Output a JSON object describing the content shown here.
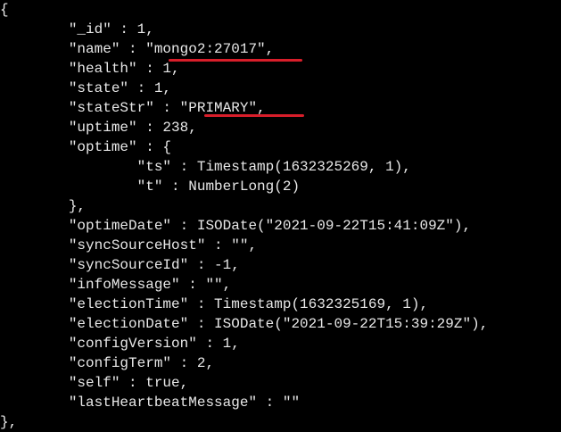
{
  "terminal": {
    "lines": [
      "{",
      "        \"_id\" : 1,",
      "        \"name\" : \"mongo2:27017\",",
      "        \"health\" : 1,",
      "        \"state\" : 1,",
      "        \"stateStr\" : \"PRIMARY\",",
      "        \"uptime\" : 238,",
      "        \"optime\" : {",
      "                \"ts\" : Timestamp(1632325269, 1),",
      "                \"t\" : NumberLong(2)",
      "        },",
      "        \"optimeDate\" : ISODate(\"2021-09-22T15:41:09Z\"),",
      "        \"syncSourceHost\" : \"\",",
      "        \"syncSourceId\" : -1,",
      "        \"infoMessage\" : \"\",",
      "        \"electionTime\" : Timestamp(1632325169, 1),",
      "        \"electionDate\" : ISODate(\"2021-09-22T15:39:29Z\"),",
      "        \"configVersion\" : 1,",
      "        \"configTerm\" : 2,",
      "        \"self\" : true,",
      "        \"lastHeartbeatMessage\" : \"\"",
      "},"
    ]
  },
  "colors": {
    "background": "#000000",
    "text": "#e8e8e8",
    "highlight_underline": "#d81e2a"
  }
}
